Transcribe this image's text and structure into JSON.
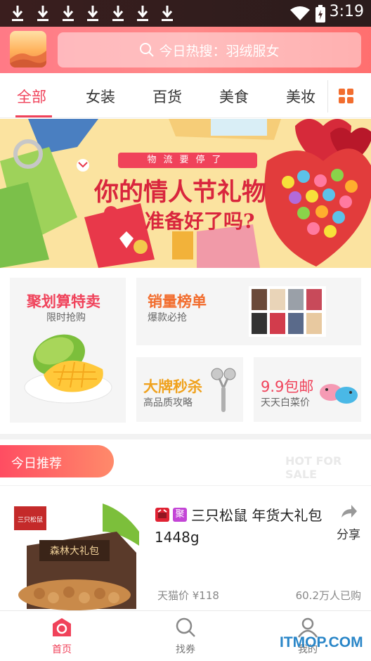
{
  "status_bar": {
    "time": "3:19"
  },
  "header": {
    "search_text": "今日热搜：羽绒服女"
  },
  "tabs": [
    {
      "label": "全部",
      "active": true
    },
    {
      "label": "女装"
    },
    {
      "label": "百货"
    },
    {
      "label": "美食"
    },
    {
      "label": "美妆"
    }
  ],
  "banner": {
    "subtitle": "物流要停了",
    "title": "你的情人节礼物",
    "title2": "准备好了吗?"
  },
  "promos": {
    "big": {
      "title": "聚划算特卖",
      "sub": "限时抢购"
    },
    "rank": {
      "title": "销量榜单",
      "sub": "爆款必抢"
    },
    "brand": {
      "title": "大牌秒杀",
      "sub": "高品质攻略"
    },
    "deal99": {
      "title": "9.9包邮",
      "sub": "天天白菜价"
    }
  },
  "recommend": {
    "title": "今日推荐",
    "hot": "HOT FOR SALE"
  },
  "product": {
    "tag2": "聚",
    "title": "三只松鼠 年货大礼包1448g",
    "price": "天猫价 ¥118",
    "sold": "60.2万人已购",
    "share": "分享",
    "brand_logo": "三只松鼠"
  },
  "bottom_nav": [
    {
      "label": "首页",
      "icon": "home-icon",
      "active": true
    },
    {
      "label": "找券",
      "icon": "search-icon"
    },
    {
      "label": "我的",
      "icon": "user-icon"
    }
  ],
  "watermark": "ITMOP.COM",
  "colors": {
    "accent": "#f0425a",
    "header": "#ff7a86",
    "promo_orange": "#f26d2e"
  }
}
